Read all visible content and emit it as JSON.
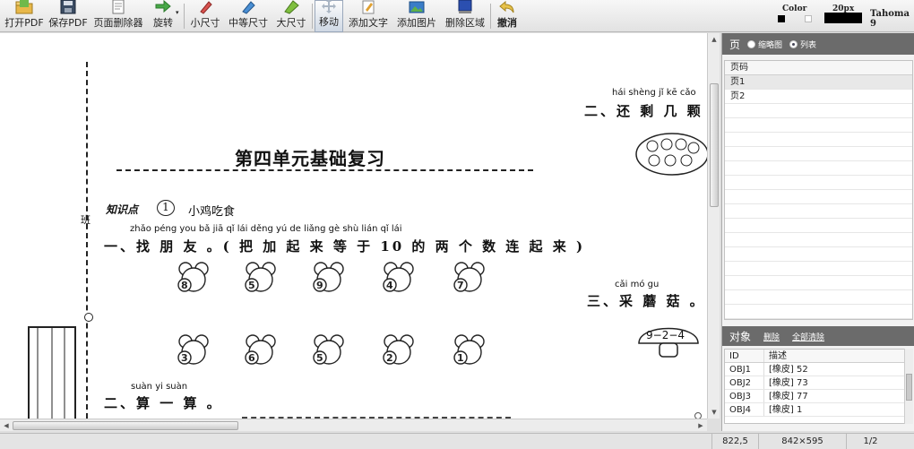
{
  "toolbar": {
    "buttons": [
      {
        "label": "打开PDF",
        "icon": "open-folder-icon"
      },
      {
        "label": "保存PDF",
        "icon": "save-disk-icon"
      },
      {
        "label": "页面删除器",
        "icon": "page-delete-icon"
      },
      {
        "label": "旋转",
        "icon": "rotate-arrows-icon"
      },
      {
        "label": "小尺寸",
        "icon": "small-eraser-icon"
      },
      {
        "label": "中等尺寸",
        "icon": "medium-eraser-icon"
      },
      {
        "label": "大尺寸",
        "icon": "large-eraser-icon"
      },
      {
        "label": "移动",
        "icon": "move-arrows-icon"
      },
      {
        "label": "添加文字",
        "icon": "add-text-icon"
      },
      {
        "label": "添加图片",
        "icon": "add-image-icon"
      },
      {
        "label": "删除区域",
        "icon": "delete-area-icon"
      },
      {
        "label": "撤消",
        "icon": "undo-icon"
      }
    ],
    "color_label": "Color",
    "size_label": "20px",
    "font_label": "Tahoma 9",
    "colors": {
      "primary": "#000000",
      "secondary": "#ffffff"
    }
  },
  "document": {
    "title": "第四单元基础复习",
    "knowledge_point": "知识点",
    "knowledge_number": "1",
    "knowledge_topic": "小鸡吃食",
    "q1_pinyin": "zhǎo péng you          bǎ  jiā  qǐ  lái  děng  yú         de  liǎng  gè  shù  lián  qǐ  lái",
    "q1_text": "一、找 朋 友 。( 把 加 起 来 等 于 10 的 两 个 数 连 起 来 )",
    "koalas_row1": [
      "8",
      "5",
      "9",
      "4",
      "7"
    ],
    "koalas_row2": [
      "3",
      "6",
      "5",
      "2",
      "1"
    ],
    "q2_pinyin": "suàn  yi  suàn",
    "q2_text": "二、算 一 算 。",
    "right_q2_pinyin": "hái  shèng  jǐ   kē  cǎo",
    "right_q2_text": "二、还  剩  几  颗  草",
    "right_q3_pinyin": "cǎi  mó  gu",
    "right_q3_text": "三、采 蘑 菇 。",
    "mushroom_text": "9−2−4",
    "side_label": "班"
  },
  "panel": {
    "pages_title": "页",
    "thumb_option": "缩略图",
    "list_option": "列表",
    "page_list_header": "页码",
    "pages": [
      "页1",
      "页2"
    ],
    "objects_title": "对象",
    "delete_action": "删除",
    "clear_all_action": "全部清除",
    "obj_columns": [
      "ID",
      "描述"
    ],
    "objects": [
      {
        "id": "OBJ1",
        "desc": "[橡皮] 52"
      },
      {
        "id": "OBJ2",
        "desc": "[橡皮] 73"
      },
      {
        "id": "OBJ3",
        "desc": "[橡皮] 77"
      },
      {
        "id": "OBJ4",
        "desc": "[橡皮] 1"
      }
    ]
  },
  "status": {
    "coords": "822,5",
    "page_size": "842×595",
    "page_index": "1/2"
  }
}
